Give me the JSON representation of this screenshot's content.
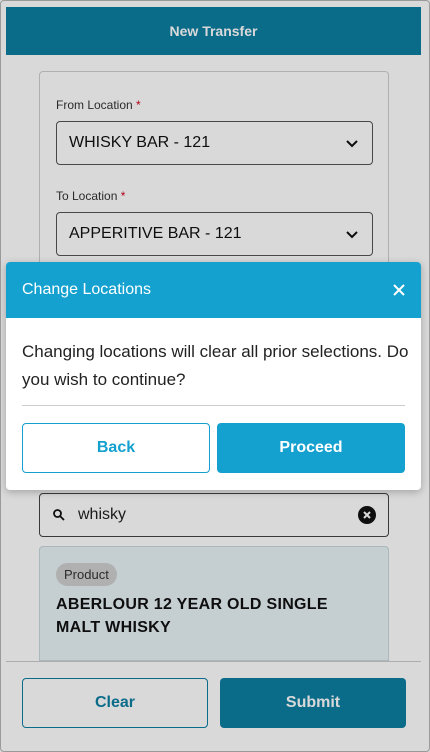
{
  "header": {
    "title": "New Transfer"
  },
  "form": {
    "from_label": "From Location",
    "from_value": "WHISKY BAR - 121",
    "to_label": "To Location",
    "to_value": "APPERITIVE BAR - 121",
    "required_mark": "*"
  },
  "search": {
    "value": "whisky"
  },
  "product": {
    "badge": "Product",
    "name": "ABERLOUR 12 YEAR OLD SINGLE MALT WHISKY"
  },
  "footer": {
    "clear_label": "Clear",
    "submit_label": "Submit"
  },
  "dialog": {
    "title": "Change Locations",
    "message": "Changing locations will clear all prior selections. Do you wish to continue?",
    "back_label": "Back",
    "proceed_label": "Proceed"
  },
  "colors": {
    "header": "#0e7fa3",
    "dialog_accent": "#14a1cf",
    "required": "#d0021b"
  }
}
